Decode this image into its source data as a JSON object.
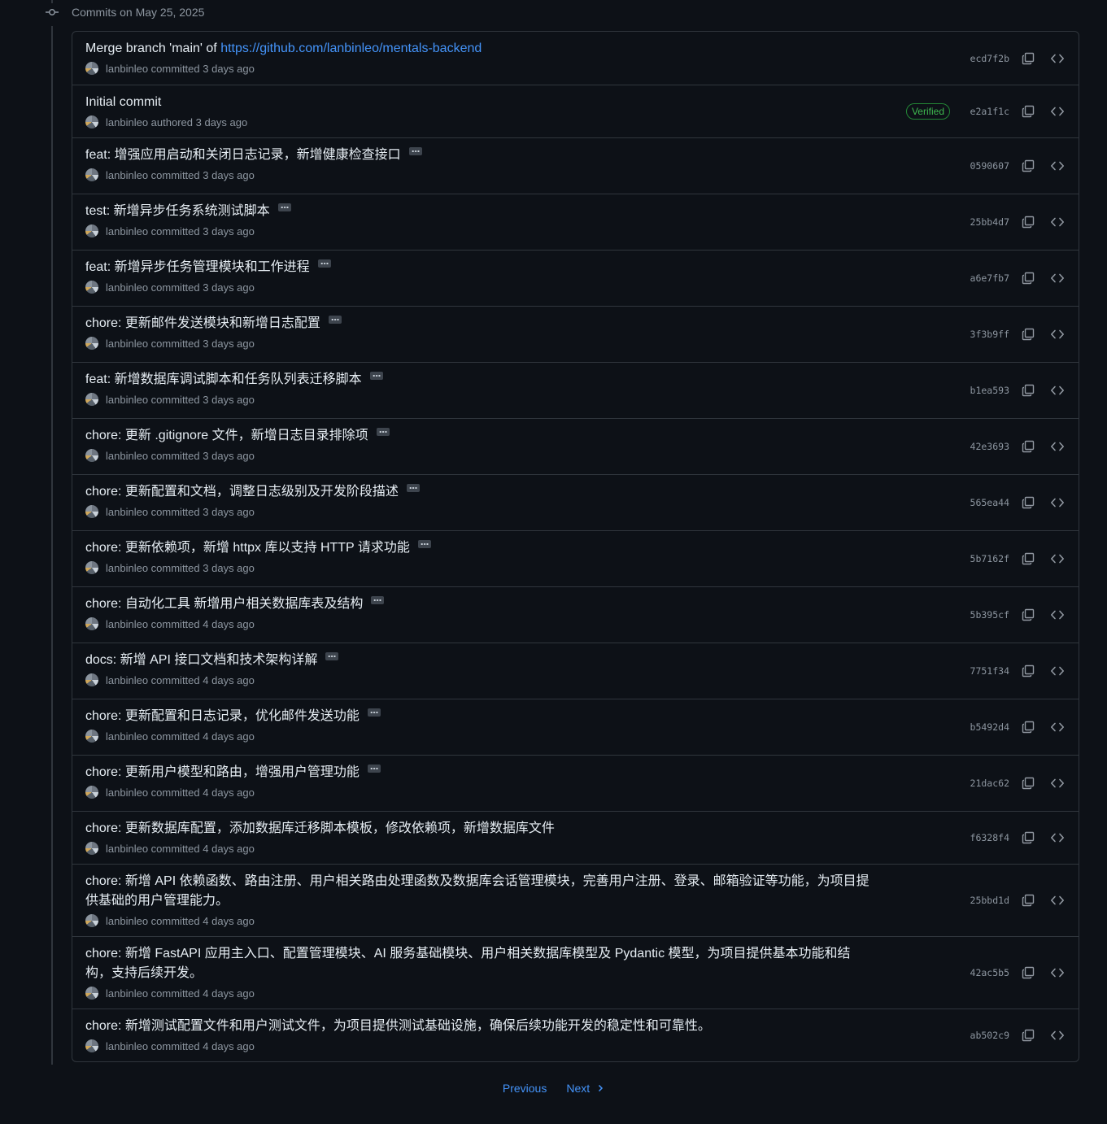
{
  "group": {
    "title": "Commits on May 25, 2025"
  },
  "commits": [
    {
      "title_prefix": "Merge branch 'main' of ",
      "title_link": "https://github.com/lanbinleo/mentals-backend",
      "has_more": false,
      "author": "lanbinleo",
      "action": "committed",
      "time": "3 days ago",
      "verified": false,
      "sha": "ecd7f2b"
    },
    {
      "title_prefix": "Initial commit",
      "title_link": "",
      "has_more": false,
      "author": "lanbinleo",
      "action": "authored",
      "time": "3 days ago",
      "verified": true,
      "verified_label": "Verified",
      "sha": "e2a1f1c"
    },
    {
      "title_prefix": "feat: 增强应用启动和关闭日志记录，新增健康检查接口",
      "title_link": "",
      "has_more": true,
      "author": "lanbinleo",
      "action": "committed",
      "time": "3 days ago",
      "verified": false,
      "sha": "0590607"
    },
    {
      "title_prefix": "test: 新增异步任务系统测试脚本",
      "title_link": "",
      "has_more": true,
      "author": "lanbinleo",
      "action": "committed",
      "time": "3 days ago",
      "verified": false,
      "sha": "25bb4d7"
    },
    {
      "title_prefix": "feat: 新增异步任务管理模块和工作进程",
      "title_link": "",
      "has_more": true,
      "author": "lanbinleo",
      "action": "committed",
      "time": "3 days ago",
      "verified": false,
      "sha": "a6e7fb7"
    },
    {
      "title_prefix": "chore: 更新邮件发送模块和新增日志配置",
      "title_link": "",
      "has_more": true,
      "author": "lanbinleo",
      "action": "committed",
      "time": "3 days ago",
      "verified": false,
      "sha": "3f3b9ff"
    },
    {
      "title_prefix": "feat: 新增数据库调试脚本和任务队列表迁移脚本",
      "title_link": "",
      "has_more": true,
      "author": "lanbinleo",
      "action": "committed",
      "time": "3 days ago",
      "verified": false,
      "sha": "b1ea593"
    },
    {
      "title_prefix": "chore: 更新 .gitignore 文件，新增日志目录排除项",
      "title_link": "",
      "has_more": true,
      "author": "lanbinleo",
      "action": "committed",
      "time": "3 days ago",
      "verified": false,
      "sha": "42e3693"
    },
    {
      "title_prefix": "chore: 更新配置和文档，调整日志级别及开发阶段描述",
      "title_link": "",
      "has_more": true,
      "author": "lanbinleo",
      "action": "committed",
      "time": "3 days ago",
      "verified": false,
      "sha": "565ea44"
    },
    {
      "title_prefix": "chore: 更新依赖项，新增 httpx 库以支持 HTTP 请求功能",
      "title_link": "",
      "has_more": true,
      "author": "lanbinleo",
      "action": "committed",
      "time": "3 days ago",
      "verified": false,
      "sha": "5b7162f"
    },
    {
      "title_prefix": "chore: 自动化工具 新增用户相关数据库表及结构",
      "title_link": "",
      "has_more": true,
      "author": "lanbinleo",
      "action": "committed",
      "time": "4 days ago",
      "verified": false,
      "sha": "5b395cf"
    },
    {
      "title_prefix": "docs: 新增 API 接口文档和技术架构详解",
      "title_link": "",
      "has_more": true,
      "author": "lanbinleo",
      "action": "committed",
      "time": "4 days ago",
      "verified": false,
      "sha": "7751f34"
    },
    {
      "title_prefix": "chore: 更新配置和日志记录，优化邮件发送功能",
      "title_link": "",
      "has_more": true,
      "author": "lanbinleo",
      "action": "committed",
      "time": "4 days ago",
      "verified": false,
      "sha": "b5492d4"
    },
    {
      "title_prefix": "chore: 更新用户模型和路由，增强用户管理功能",
      "title_link": "",
      "has_more": true,
      "author": "lanbinleo",
      "action": "committed",
      "time": "4 days ago",
      "verified": false,
      "sha": "21dac62"
    },
    {
      "title_prefix": "chore: 更新数据库配置，添加数据库迁移脚本模板，修改依赖项，新增数据库文件",
      "title_link": "",
      "has_more": false,
      "author": "lanbinleo",
      "action": "committed",
      "time": "4 days ago",
      "verified": false,
      "sha": "f6328f4"
    },
    {
      "title_prefix": "chore: 新增 API 依赖函数、路由注册、用户相关路由处理函数及数据库会话管理模块，完善用户注册、登录、邮箱验证等功能，为项目提供基础的用户管理能力。",
      "title_link": "",
      "has_more": false,
      "author": "lanbinleo",
      "action": "committed",
      "time": "4 days ago",
      "verified": false,
      "sha": "25bbd1d"
    },
    {
      "title_prefix": "chore: 新增 FastAPI 应用主入口、配置管理模块、AI 服务基础模块、用户相关数据库模型及 Pydantic 模型，为项目提供基本功能和结构，支持后续开发。",
      "title_link": "",
      "has_more": false,
      "author": "lanbinleo",
      "action": "committed",
      "time": "4 days ago",
      "verified": false,
      "sha": "42ac5b5"
    },
    {
      "title_prefix": "chore: 新增测试配置文件和用户测试文件，为项目提供测试基础设施，确保后续功能开发的稳定性和可靠性。",
      "title_link": "",
      "has_more": false,
      "author": "lanbinleo",
      "action": "committed",
      "time": "4 days ago",
      "verified": false,
      "sha": "ab502c9"
    }
  ],
  "pagination": {
    "previous": "Previous",
    "next": "Next"
  }
}
